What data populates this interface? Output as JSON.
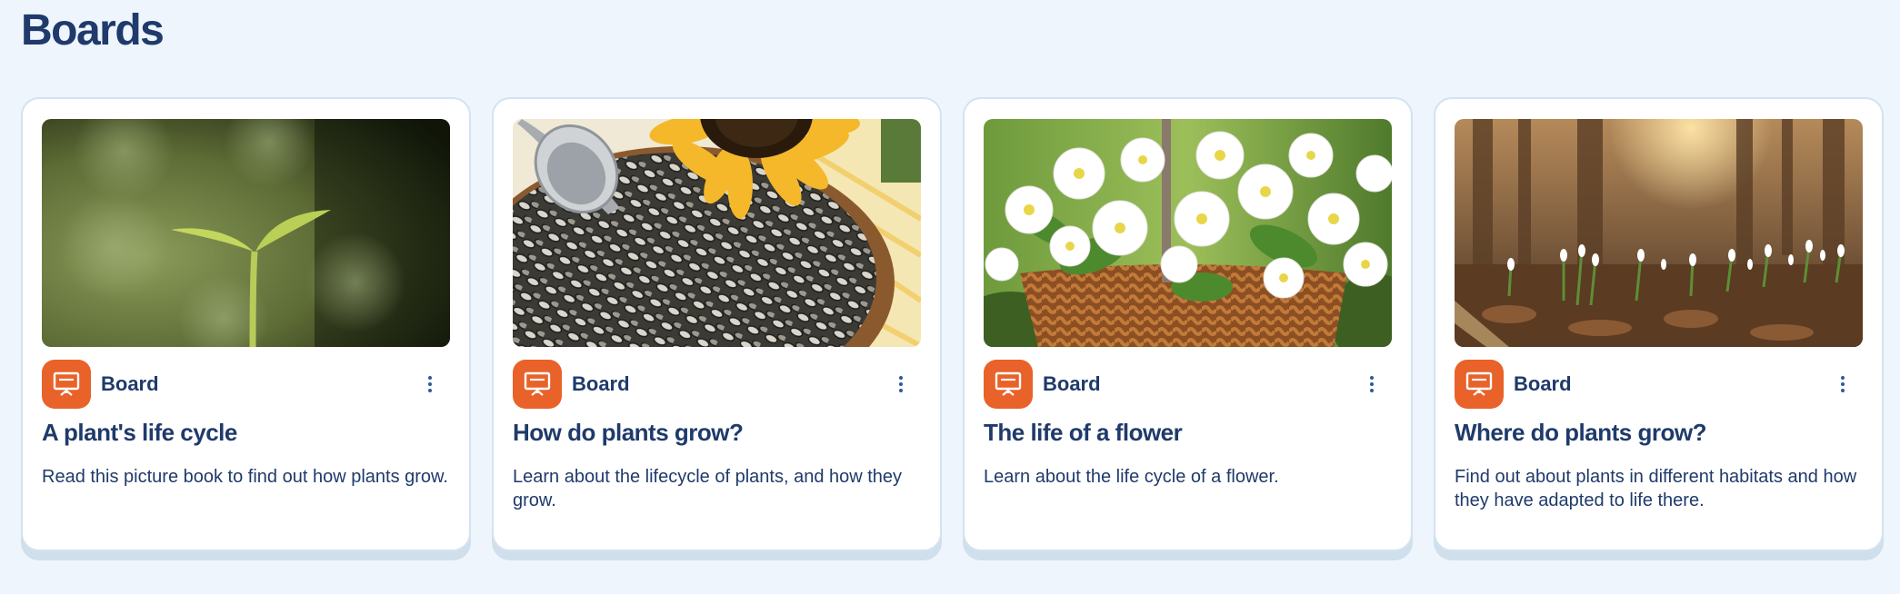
{
  "page": {
    "title": "Boards"
  },
  "colors": {
    "accent": "#e8622a",
    "text": "#1f3a6b",
    "background": "#eef5fd"
  },
  "cards": [
    {
      "type_icon": "presentation-board-icon",
      "type_label": "Board",
      "title": "A plant's life cycle",
      "description": "Read this picture book to find out how plants grow.",
      "image": "seedling-sprout"
    },
    {
      "type_icon": "presentation-board-icon",
      "type_label": "Board",
      "title": "How do plants grow?",
      "description": "Learn about the lifecycle of plants, and how they grow.",
      "image": "sunflower-seeds"
    },
    {
      "type_icon": "presentation-board-icon",
      "type_label": "Board",
      "title": "The life of a flower",
      "description": "Learn about the life cycle of a flower.",
      "image": "flower-basket"
    },
    {
      "type_icon": "presentation-board-icon",
      "type_label": "Board",
      "title": "Where do plants grow?",
      "description": "Find out about plants in different habitats and how they have adapted to life there.",
      "image": "forest-snowdrops"
    }
  ]
}
